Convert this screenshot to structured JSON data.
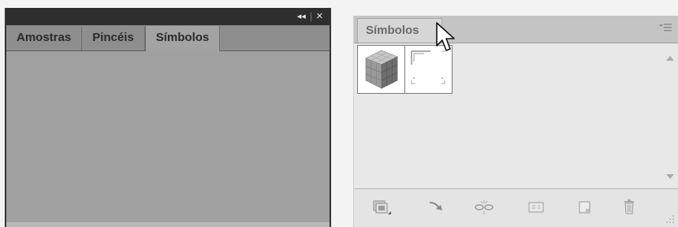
{
  "left_panel": {
    "collapse_glyph": "◂◂",
    "close_glyph": "✕",
    "tabs": [
      {
        "label": "Amostras"
      },
      {
        "label": "Pincéis"
      },
      {
        "label": "Símbolos"
      }
    ]
  },
  "right_panel": {
    "tab_label": "Símbolos",
    "symbols": [
      {
        "icon": "cube-symbol-icon"
      },
      {
        "icon": "frame-symbol-icon"
      }
    ],
    "toolbar": [
      "symbol-library-menu-icon",
      "place-symbol-instance-icon",
      "break-link-icon",
      "symbol-options-icon",
      "new-symbol-icon",
      "delete-symbol-icon"
    ]
  },
  "colors": {
    "left_titlebar": "#2e2e2e",
    "left_body": "#a0a0a0",
    "right_body": "#e8e8e8"
  }
}
